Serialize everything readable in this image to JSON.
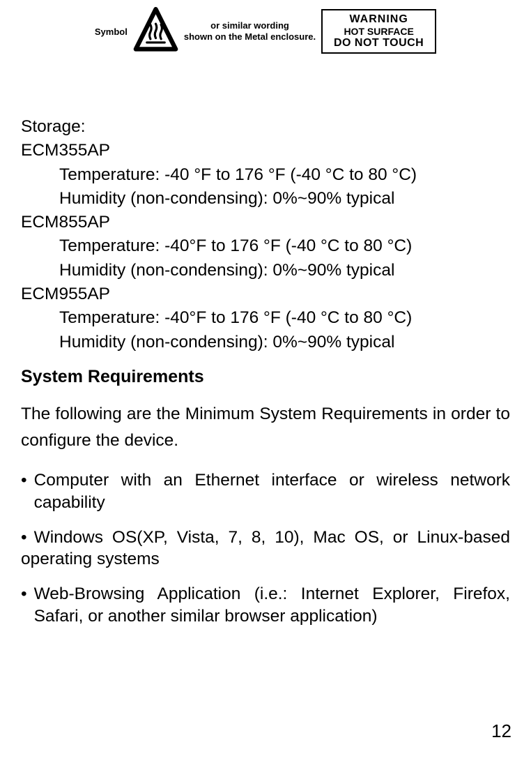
{
  "warning_strip": {
    "symbol_label": "Symbol",
    "similar_line1": "or similar wording",
    "similar_line2": "shown on the Metal enclosure.",
    "box_line1": "WARNING",
    "box_line2": "HOT SURFACE",
    "box_line3": "DO NOT TOUCH"
  },
  "storage": {
    "title": "Storage:",
    "models": [
      {
        "name": "ECM355AP",
        "temp": "Temperature: -40 °F to 176 °F (-40 °C to 80 °C)",
        "humidity": "Humidity (non-condensing): 0%~90% typical"
      },
      {
        "name": "ECM855AP",
        "temp": "Temperature: -40°F to 176 °F (-40 °C to 80 °C)",
        "humidity": "Humidity (non-condensing): 0%~90% typical"
      },
      {
        "name": "ECM955AP",
        "temp": "Temperature: -40°F to 176 °F (-40 °C to 80 °C)",
        "humidity": "Humidity (non-condensing): 0%~90% typical"
      }
    ]
  },
  "sysreq": {
    "heading": "System Requirements",
    "intro": "The following are the Minimum System Requirements in order to configure the device.",
    "bullets": [
      "Computer with an Ethernet interface or wireless network capability",
      "Windows OS(XP, Vista, 7, 8, 10), Mac OS, or Linux-based operating systems",
      "Web-Browsing Application (i.e.: Internet Explorer, Firefox, Safari, or another similar browser application)"
    ]
  },
  "page_number": "12"
}
